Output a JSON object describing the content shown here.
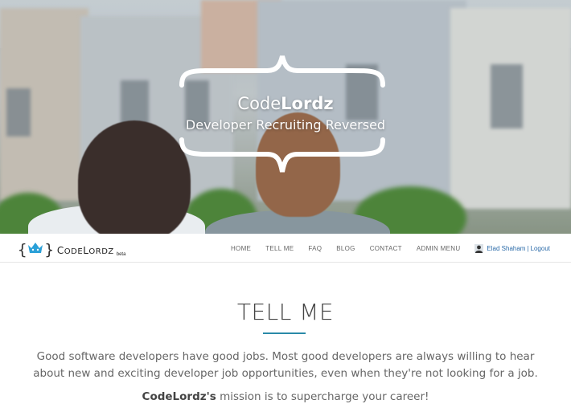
{
  "hero": {
    "title_light": "Code",
    "title_bold": "Lordz",
    "subtitle": "Developer Recruiting Reversed"
  },
  "navbar": {
    "brand": {
      "brace_open": "{",
      "brace_close": "}",
      "name_first": "C",
      "name_rest_1": "ODE",
      "name_second": "L",
      "name_rest_2": "ORDZ",
      "beta": "beta"
    },
    "links": [
      {
        "label": "HOME"
      },
      {
        "label": "TELL ME"
      },
      {
        "label": "FAQ"
      },
      {
        "label": "BLOG"
      },
      {
        "label": "CONTACT"
      },
      {
        "label": "ADMIN MENU"
      }
    ],
    "user": {
      "name": "Elad Shaham",
      "separator": "|",
      "logout": "Logout"
    }
  },
  "content": {
    "title": "TELL ME",
    "intro": "Good software developers have good jobs. Most good developers are always willing to hear about new and exciting developer job opportunities, even when they're not looking for a job.",
    "mission_bold": "CodeLordz's",
    "mission_rest": " mission is to supercharge your career!"
  },
  "colors": {
    "accent": "#2a8aa8",
    "link": "#2a6aa8",
    "crown": "#2aa0d8"
  },
  "icons": [
    "crown-icon",
    "user-avatar-icon"
  ]
}
